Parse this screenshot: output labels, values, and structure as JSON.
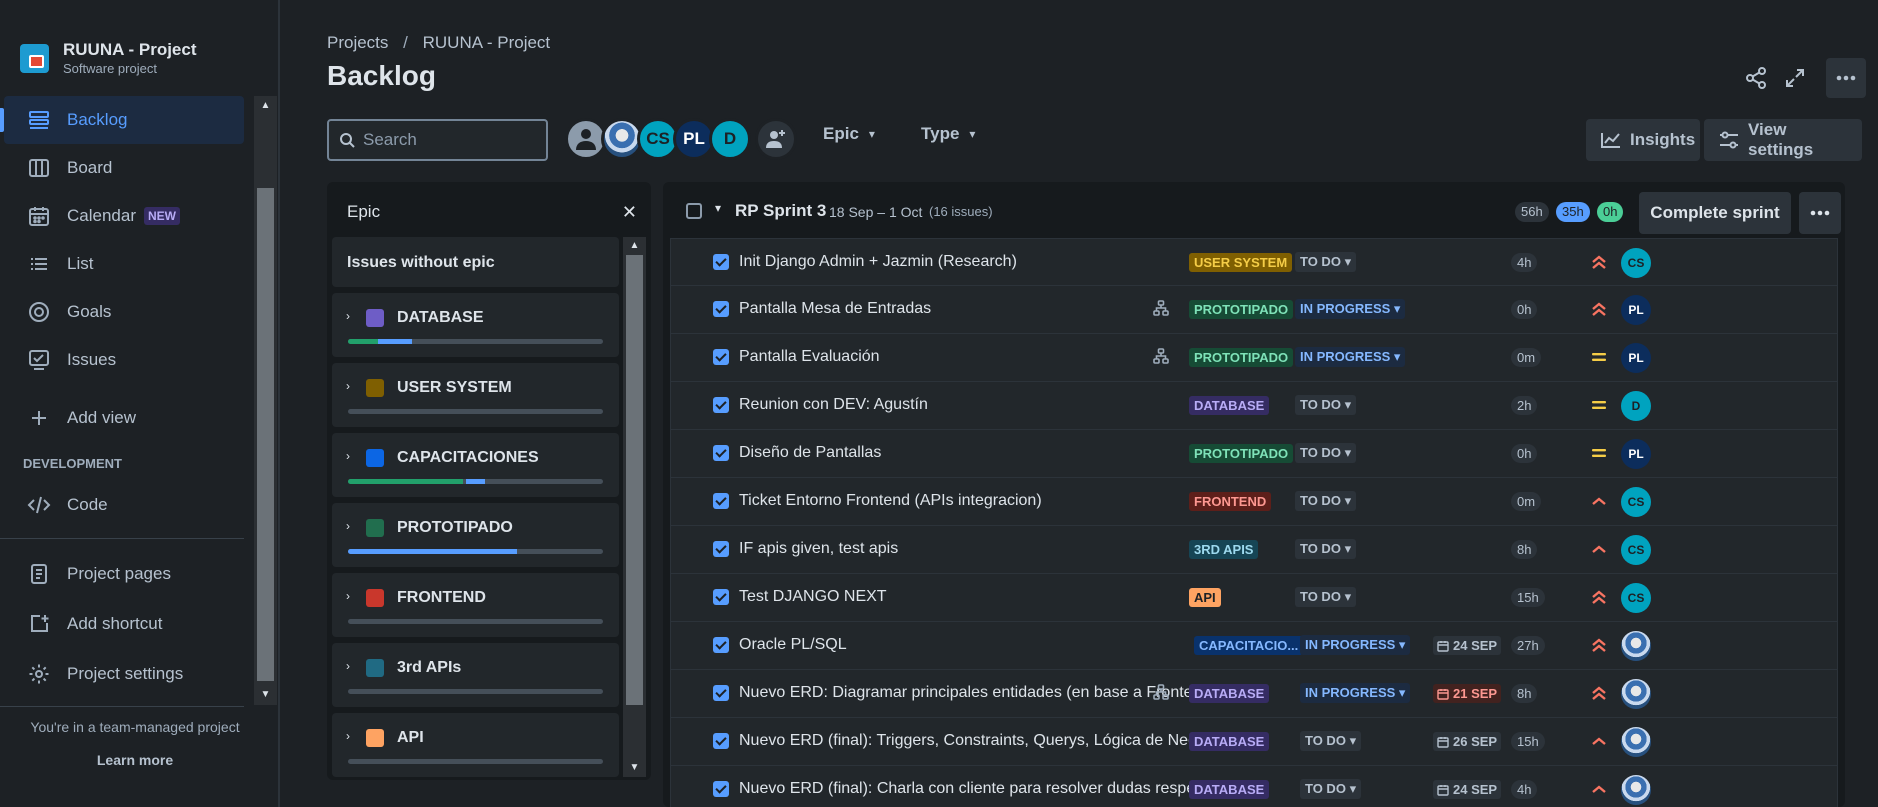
{
  "project": {
    "name": "RUUNA - Project",
    "type": "Software project"
  },
  "nav": {
    "items": [
      {
        "label": "Backlog",
        "icon": "backlog-icon",
        "active": true
      },
      {
        "label": "Board",
        "icon": "board-icon"
      },
      {
        "label": "Calendar",
        "icon": "calendar-icon",
        "badge": "NEW"
      },
      {
        "label": "List",
        "icon": "list-icon"
      },
      {
        "label": "Goals",
        "icon": "goals-icon"
      },
      {
        "label": "Issues",
        "icon": "issues-icon"
      },
      {
        "label": "Add view",
        "icon": "plus-icon"
      }
    ],
    "section": "DEVELOPMENT",
    "code": "Code",
    "pages": "Project pages",
    "shortcut": "Add shortcut",
    "settings": "Project settings",
    "footer_text": "You're in a team-managed project",
    "footer_link": "Learn more"
  },
  "breadcrumb": {
    "projects": "Projects",
    "separator": "/",
    "current": "RUUNA - Project"
  },
  "page_title": "Backlog",
  "search": {
    "placeholder": "Search"
  },
  "avatars": [
    "CS",
    "PL",
    "D"
  ],
  "filters": {
    "epic": "Epic",
    "type": "Type"
  },
  "buttons": {
    "insights": "Insights",
    "view_settings": "View settings",
    "complete_sprint": "Complete sprint"
  },
  "epic_panel": {
    "title": "Epic",
    "no_epic": "Issues without epic",
    "epics": [
      {
        "name": "DATABASE",
        "color": "#6e5dc6"
      },
      {
        "name": "USER SYSTEM",
        "color": "#7f5f01"
      },
      {
        "name": "CAPACITACIONES",
        "color": "#0c66e4"
      },
      {
        "name": "PROTOTIPADO",
        "color": "#216e4e"
      },
      {
        "name": "FRONTEND",
        "color": "#c9372c"
      },
      {
        "name": "3rd APIs",
        "color": "#206a83"
      },
      {
        "name": "API",
        "color": "#fea362"
      }
    ]
  },
  "sprint": {
    "name": "RP Sprint 3",
    "dates": "18 Sep – 1 Oct",
    "count": "(16 issues)",
    "todo_est": "56h",
    "inprogress_est": "35h",
    "done_est": "0h"
  },
  "issues": [
    {
      "summary": "Init Django Admin + Jazmin (Research)",
      "epic": "USER SYSTEM",
      "status": "TO DO",
      "due": "",
      "est": "4h",
      "priority": "highest",
      "assignee": "CS"
    },
    {
      "summary": "Pantalla Mesa de Entradas",
      "epic": "PROTOTIPADO",
      "status": "IN PROGRESS",
      "due": "",
      "est": "0h",
      "priority": "highest",
      "assignee": "PL",
      "child": true
    },
    {
      "summary": "Pantalla Evaluación",
      "epic": "PROTOTIPADO",
      "status": "IN PROGRESS",
      "due": "",
      "est": "0m",
      "priority": "medium",
      "assignee": "PL",
      "child": true
    },
    {
      "summary": "Reunion con DEV: Agustín",
      "epic": "DATABASE",
      "status": "TO DO",
      "due": "",
      "est": "2h",
      "priority": "medium",
      "assignee": "D"
    },
    {
      "summary": "Diseño de Pantallas",
      "epic": "PROTOTIPADO",
      "status": "TO DO",
      "due": "",
      "est": "0h",
      "priority": "medium",
      "assignee": "PL"
    },
    {
      "summary": "Ticket Entorno Frontend (APIs integracion)",
      "epic": "FRONTEND",
      "status": "TO DO",
      "due": "",
      "est": "0m",
      "priority": "high",
      "assignee": "CS"
    },
    {
      "summary": "IF apis given, test apis",
      "epic": "3RD APIS",
      "status": "TO DO",
      "due": "",
      "est": "8h",
      "priority": "high",
      "assignee": "CS"
    },
    {
      "summary": "Test DJANGO NEXT",
      "epic": "API",
      "status": "TO DO",
      "due": "",
      "est": "15h",
      "priority": "highest",
      "assignee": "CS"
    },
    {
      "summary": "Oracle PL/SQL",
      "epic": "CAPACITACIO...",
      "status": "IN PROGRESS",
      "due": "24 SEP",
      "est": "27h",
      "priority": "highest",
      "assignee": "photo"
    },
    {
      "summary": "Nuevo ERD: Diagramar principales entidades (en base a Frontend)",
      "epic": "DATABASE",
      "status": "IN PROGRESS",
      "due": "21 SEP",
      "overdue": true,
      "est": "8h",
      "priority": "highest",
      "assignee": "photo",
      "child": true
    },
    {
      "summary": "Nuevo ERD (final): Triggers, Constraints, Querys, Lógica de Negocios...",
      "epic": "DATABASE",
      "status": "TO DO",
      "due": "26 SEP",
      "est": "15h",
      "priority": "high",
      "assignee": "photo"
    },
    {
      "summary": "Nuevo ERD (final): Charla con cliente para resolver dudas respecto l...",
      "epic": "DATABASE",
      "status": "TO DO",
      "due": "24 SEP",
      "est": "4h",
      "priority": "high",
      "assignee": "photo"
    }
  ]
}
